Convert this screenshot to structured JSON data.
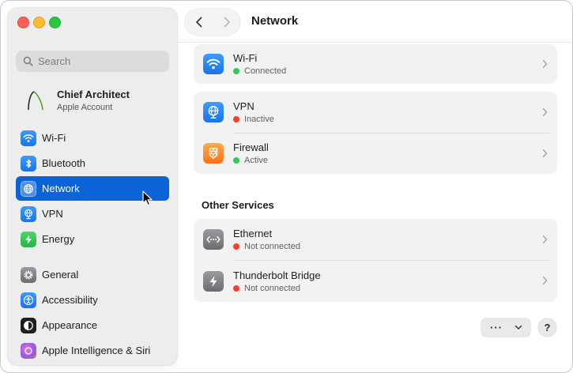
{
  "window": {
    "title": "Network"
  },
  "sidebar": {
    "search_placeholder": "Search",
    "account": {
      "name": "Chief Architect",
      "subtitle": "Apple Account"
    },
    "items": [
      {
        "label": "Wi-Fi",
        "icon": "wifi-icon"
      },
      {
        "label": "Bluetooth",
        "icon": "bluetooth-icon"
      },
      {
        "label": "Network",
        "icon": "globe-icon",
        "selected": true
      },
      {
        "label": "VPN",
        "icon": "vpn-globe-icon"
      },
      {
        "label": "Energy",
        "icon": "bolt-icon"
      },
      {
        "label": "General",
        "icon": "gear-icon"
      },
      {
        "label": "Accessibility",
        "icon": "accessibility-icon"
      },
      {
        "label": "Appearance",
        "icon": "appearance-icon"
      },
      {
        "label": "Apple Intelligence & Siri",
        "icon": "siri-icon"
      }
    ]
  },
  "services": [
    {
      "title": "Wi-Fi",
      "status": "Connected",
      "status_color": "#34c759",
      "icon": "wifi-icon"
    },
    {
      "title": "VPN",
      "status": "Inactive",
      "status_color": "#ff3b30",
      "icon": "vpn-globe-icon"
    },
    {
      "title": "Firewall",
      "status": "Active",
      "status_color": "#34c759",
      "icon": "firewall-icon"
    }
  ],
  "other_services": {
    "heading": "Other Services",
    "items": [
      {
        "title": "Ethernet",
        "status": "Not connected",
        "status_color": "#ff3b30",
        "icon": "ethernet-icon"
      },
      {
        "title": "Thunderbolt Bridge",
        "status": "Not connected",
        "status_color": "#ff3b30",
        "icon": "thunderbolt-icon"
      }
    ]
  },
  "footer": {
    "more_label": "···",
    "help_label": "?"
  },
  "colors": {
    "accent": "#0b63d8",
    "green": "#34c759",
    "red": "#ff3b30"
  }
}
